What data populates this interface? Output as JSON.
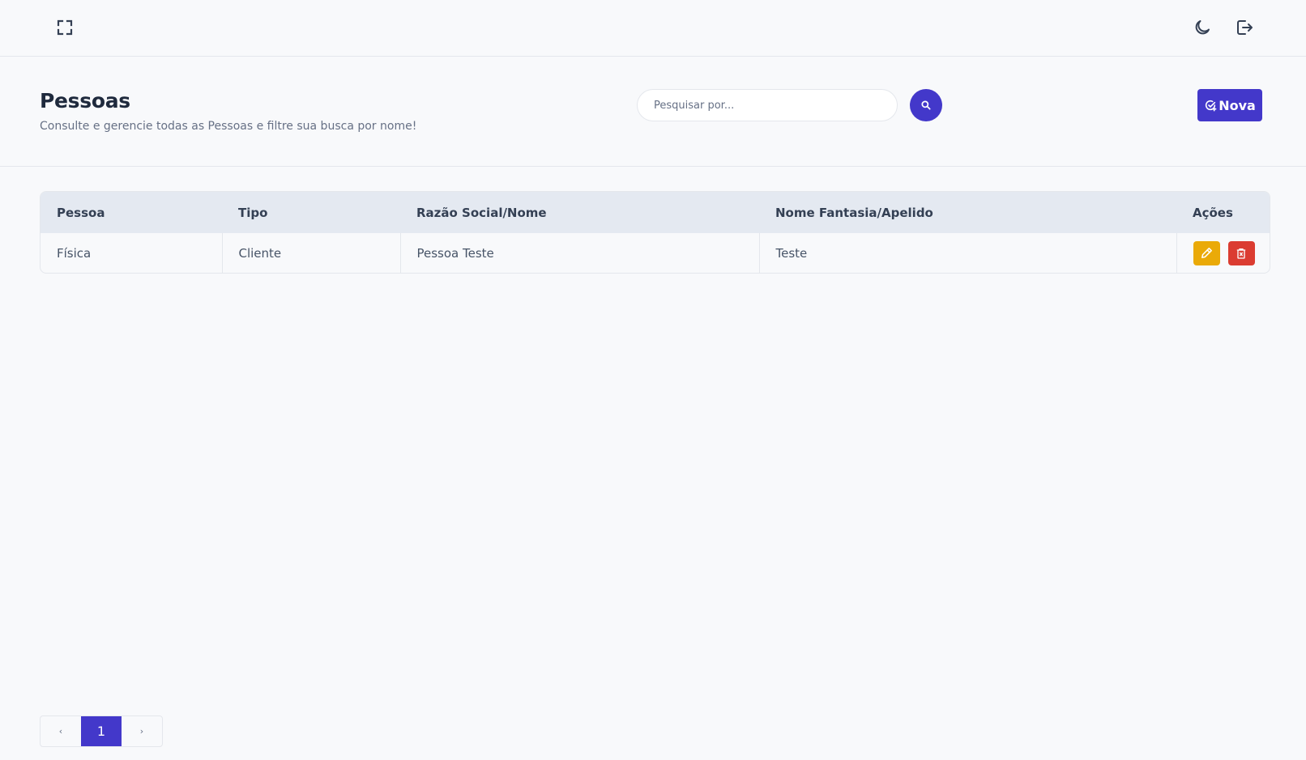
{
  "topbar": {
    "fullscreen_icon": "fullscreen-icon",
    "theme_icon": "moon-icon",
    "logout_icon": "logout-icon"
  },
  "header": {
    "title": "Pessoas",
    "subtitle": "Consulte e gerencie todas as Pessoas e filtre sua busca por nome!",
    "search": {
      "placeholder": "Pesquisar por...",
      "value": ""
    },
    "new_button_label": "Nova"
  },
  "table": {
    "columns": [
      "Pessoa",
      "Tipo",
      "Razão Social/Nome",
      "Nome Fantasia/Apelido",
      "Ações"
    ],
    "rows": [
      {
        "pessoa": "Física",
        "tipo": "Cliente",
        "razao": "Pessoa Teste",
        "fantasia": "Teste"
      }
    ]
  },
  "pagination": {
    "prev": "‹",
    "current": "1",
    "next": "›"
  },
  "colors": {
    "accent": "#4338ca",
    "edit": "#eaaa08",
    "delete": "#d92d20"
  }
}
